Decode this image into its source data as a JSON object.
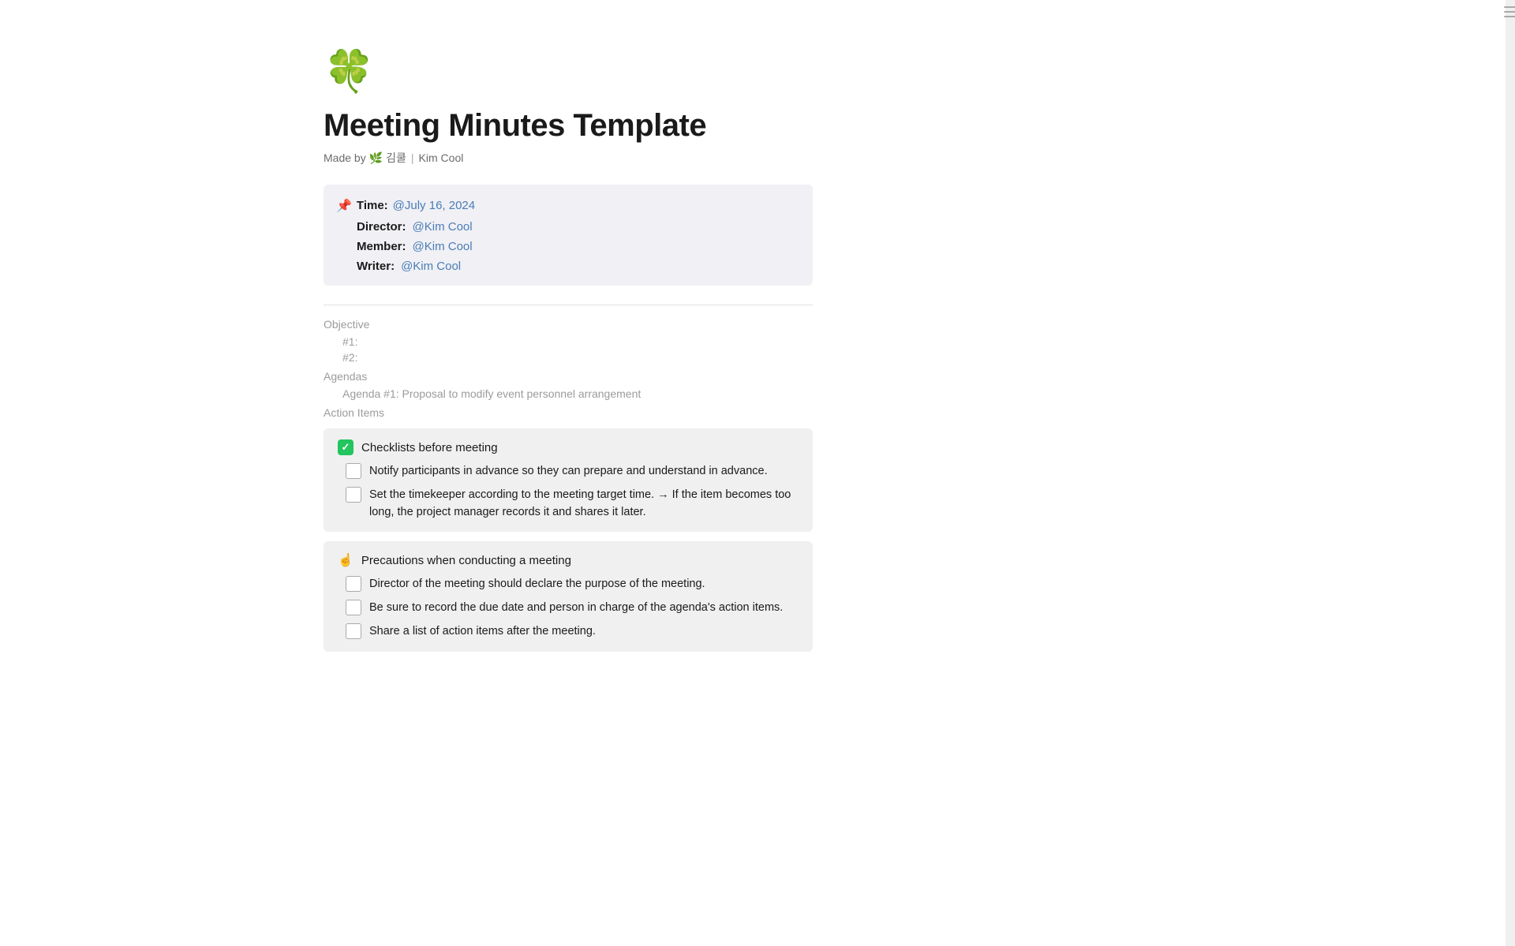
{
  "page": {
    "icon": "🍀",
    "title": "Meeting Minutes Template",
    "made_by_label": "Made by",
    "made_by_emoji": "🌿",
    "made_by_korean": "김쿨",
    "made_by_separator": "|",
    "made_by_name": "Kim Cool"
  },
  "info_block": {
    "pin_icon": "📌",
    "time_label": "Time:",
    "time_value": "@July 16, 2024",
    "director_label": "Director:",
    "director_value": "@Kim Cool",
    "member_label": "Member:",
    "member_value": "@Kim Cool",
    "writer_label": "Writer:",
    "writer_value": "@Kim Cool"
  },
  "objective": {
    "label": "Objective",
    "item1": "#1:",
    "item2": "#2:"
  },
  "agendas": {
    "label": "Agendas",
    "item1": "Agenda #1: Proposal to modify event personnel arrangement"
  },
  "action_items": {
    "label": "Action Items",
    "checklists": [
      {
        "id": "checklist1",
        "checked": true,
        "header": "Checklists before meeting",
        "header_emoji": "✅",
        "items": [
          {
            "checked": false,
            "text": "Notify participants in advance so they can prepare and understand in advance."
          },
          {
            "checked": false,
            "text": "Set the timekeeper according to the meeting target time. → If the item becomes too long, the project manager records it and shares it later."
          }
        ]
      },
      {
        "id": "checklist2",
        "checked": false,
        "header": "Precautions when conducting a meeting",
        "header_emoji": "☝",
        "items": [
          {
            "checked": false,
            "text": "Director of the meeting should declare the purpose of the meeting."
          },
          {
            "checked": false,
            "text": "Be sure to record the due date and person in charge of the agenda's action items."
          },
          {
            "checked": false,
            "text": "Share a list of action items after the meeting."
          }
        ]
      }
    ]
  },
  "scrollbar": {
    "lines": [
      "—",
      "—",
      "—"
    ]
  }
}
